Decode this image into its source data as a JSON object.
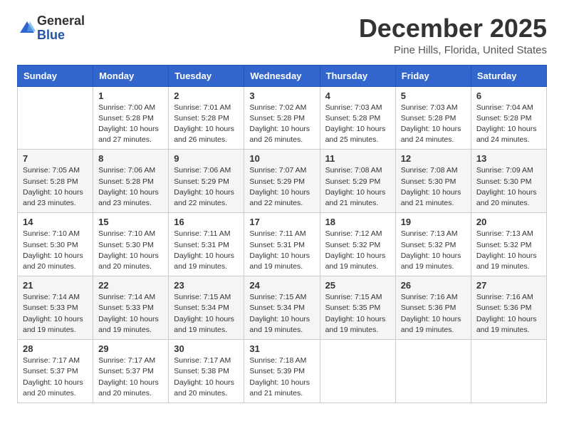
{
  "header": {
    "logo_general": "General",
    "logo_blue": "Blue",
    "month_title": "December 2025",
    "location": "Pine Hills, Florida, United States"
  },
  "days_of_week": [
    "Sunday",
    "Monday",
    "Tuesday",
    "Wednesday",
    "Thursday",
    "Friday",
    "Saturday"
  ],
  "weeks": [
    [
      {
        "day": "",
        "info": ""
      },
      {
        "day": "1",
        "info": "Sunrise: 7:00 AM\nSunset: 5:28 PM\nDaylight: 10 hours\nand 27 minutes."
      },
      {
        "day": "2",
        "info": "Sunrise: 7:01 AM\nSunset: 5:28 PM\nDaylight: 10 hours\nand 26 minutes."
      },
      {
        "day": "3",
        "info": "Sunrise: 7:02 AM\nSunset: 5:28 PM\nDaylight: 10 hours\nand 26 minutes."
      },
      {
        "day": "4",
        "info": "Sunrise: 7:03 AM\nSunset: 5:28 PM\nDaylight: 10 hours\nand 25 minutes."
      },
      {
        "day": "5",
        "info": "Sunrise: 7:03 AM\nSunset: 5:28 PM\nDaylight: 10 hours\nand 24 minutes."
      },
      {
        "day": "6",
        "info": "Sunrise: 7:04 AM\nSunset: 5:28 PM\nDaylight: 10 hours\nand 24 minutes."
      }
    ],
    [
      {
        "day": "7",
        "info": "Sunrise: 7:05 AM\nSunset: 5:28 PM\nDaylight: 10 hours\nand 23 minutes."
      },
      {
        "day": "8",
        "info": "Sunrise: 7:06 AM\nSunset: 5:28 PM\nDaylight: 10 hours\nand 23 minutes."
      },
      {
        "day": "9",
        "info": "Sunrise: 7:06 AM\nSunset: 5:29 PM\nDaylight: 10 hours\nand 22 minutes."
      },
      {
        "day": "10",
        "info": "Sunrise: 7:07 AM\nSunset: 5:29 PM\nDaylight: 10 hours\nand 22 minutes."
      },
      {
        "day": "11",
        "info": "Sunrise: 7:08 AM\nSunset: 5:29 PM\nDaylight: 10 hours\nand 21 minutes."
      },
      {
        "day": "12",
        "info": "Sunrise: 7:08 AM\nSunset: 5:30 PM\nDaylight: 10 hours\nand 21 minutes."
      },
      {
        "day": "13",
        "info": "Sunrise: 7:09 AM\nSunset: 5:30 PM\nDaylight: 10 hours\nand 20 minutes."
      }
    ],
    [
      {
        "day": "14",
        "info": "Sunrise: 7:10 AM\nSunset: 5:30 PM\nDaylight: 10 hours\nand 20 minutes."
      },
      {
        "day": "15",
        "info": "Sunrise: 7:10 AM\nSunset: 5:30 PM\nDaylight: 10 hours\nand 20 minutes."
      },
      {
        "day": "16",
        "info": "Sunrise: 7:11 AM\nSunset: 5:31 PM\nDaylight: 10 hours\nand 19 minutes."
      },
      {
        "day": "17",
        "info": "Sunrise: 7:11 AM\nSunset: 5:31 PM\nDaylight: 10 hours\nand 19 minutes."
      },
      {
        "day": "18",
        "info": "Sunrise: 7:12 AM\nSunset: 5:32 PM\nDaylight: 10 hours\nand 19 minutes."
      },
      {
        "day": "19",
        "info": "Sunrise: 7:13 AM\nSunset: 5:32 PM\nDaylight: 10 hours\nand 19 minutes."
      },
      {
        "day": "20",
        "info": "Sunrise: 7:13 AM\nSunset: 5:32 PM\nDaylight: 10 hours\nand 19 minutes."
      }
    ],
    [
      {
        "day": "21",
        "info": "Sunrise: 7:14 AM\nSunset: 5:33 PM\nDaylight: 10 hours\nand 19 minutes."
      },
      {
        "day": "22",
        "info": "Sunrise: 7:14 AM\nSunset: 5:33 PM\nDaylight: 10 hours\nand 19 minutes."
      },
      {
        "day": "23",
        "info": "Sunrise: 7:15 AM\nSunset: 5:34 PM\nDaylight: 10 hours\nand 19 minutes."
      },
      {
        "day": "24",
        "info": "Sunrise: 7:15 AM\nSunset: 5:34 PM\nDaylight: 10 hours\nand 19 minutes."
      },
      {
        "day": "25",
        "info": "Sunrise: 7:15 AM\nSunset: 5:35 PM\nDaylight: 10 hours\nand 19 minutes."
      },
      {
        "day": "26",
        "info": "Sunrise: 7:16 AM\nSunset: 5:36 PM\nDaylight: 10 hours\nand 19 minutes."
      },
      {
        "day": "27",
        "info": "Sunrise: 7:16 AM\nSunset: 5:36 PM\nDaylight: 10 hours\nand 19 minutes."
      }
    ],
    [
      {
        "day": "28",
        "info": "Sunrise: 7:17 AM\nSunset: 5:37 PM\nDaylight: 10 hours\nand 20 minutes."
      },
      {
        "day": "29",
        "info": "Sunrise: 7:17 AM\nSunset: 5:37 PM\nDaylight: 10 hours\nand 20 minutes."
      },
      {
        "day": "30",
        "info": "Sunrise: 7:17 AM\nSunset: 5:38 PM\nDaylight: 10 hours\nand 20 minutes."
      },
      {
        "day": "31",
        "info": "Sunrise: 7:18 AM\nSunset: 5:39 PM\nDaylight: 10 hours\nand 21 minutes."
      },
      {
        "day": "",
        "info": ""
      },
      {
        "day": "",
        "info": ""
      },
      {
        "day": "",
        "info": ""
      }
    ]
  ]
}
